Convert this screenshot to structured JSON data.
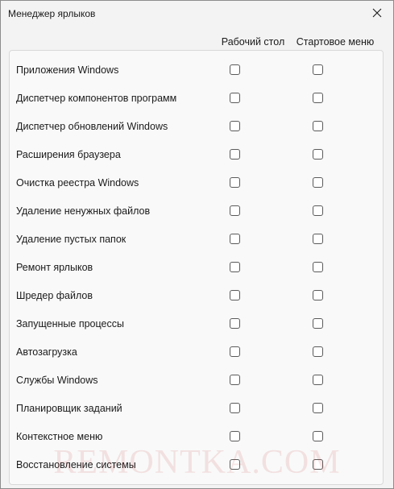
{
  "window": {
    "title": "Менеджер ярлыков"
  },
  "columns": {
    "desktop": "Рабочий стол",
    "start_menu": "Стартовое меню"
  },
  "rows": [
    {
      "label": "Приложения Windows",
      "desktop": false,
      "start_menu": false
    },
    {
      "label": "Диспетчер компонентов программ",
      "desktop": false,
      "start_menu": false
    },
    {
      "label": "Диспетчер обновлений Windows",
      "desktop": false,
      "start_menu": false
    },
    {
      "label": "Расширения браузера",
      "desktop": false,
      "start_menu": false
    },
    {
      "label": "Очистка реестра Windows",
      "desktop": false,
      "start_menu": false
    },
    {
      "label": "Удаление ненужных файлов",
      "desktop": false,
      "start_menu": false
    },
    {
      "label": "Удаление пустых папок",
      "desktop": false,
      "start_menu": false
    },
    {
      "label": "Ремонт ярлыков",
      "desktop": false,
      "start_menu": false
    },
    {
      "label": "Шредер файлов",
      "desktop": false,
      "start_menu": false
    },
    {
      "label": "Запущенные процессы",
      "desktop": false,
      "start_menu": false
    },
    {
      "label": "Автозагрузка",
      "desktop": false,
      "start_menu": false
    },
    {
      "label": "Службы Windows",
      "desktop": false,
      "start_menu": false
    },
    {
      "label": "Планировщик заданий",
      "desktop": false,
      "start_menu": false
    },
    {
      "label": "Контекстное меню",
      "desktop": false,
      "start_menu": false
    },
    {
      "label": "Восстановление системы",
      "desktop": false,
      "start_menu": false
    }
  ],
  "watermark": "REMONTKA.COM",
  "icons": {
    "close": "close-icon"
  },
  "colors": {
    "window_bg": "#f3f3f3",
    "panel_bg": "#f9f9f9",
    "text": "#1a1a1a",
    "checkbox_border": "#5a5a5a"
  }
}
